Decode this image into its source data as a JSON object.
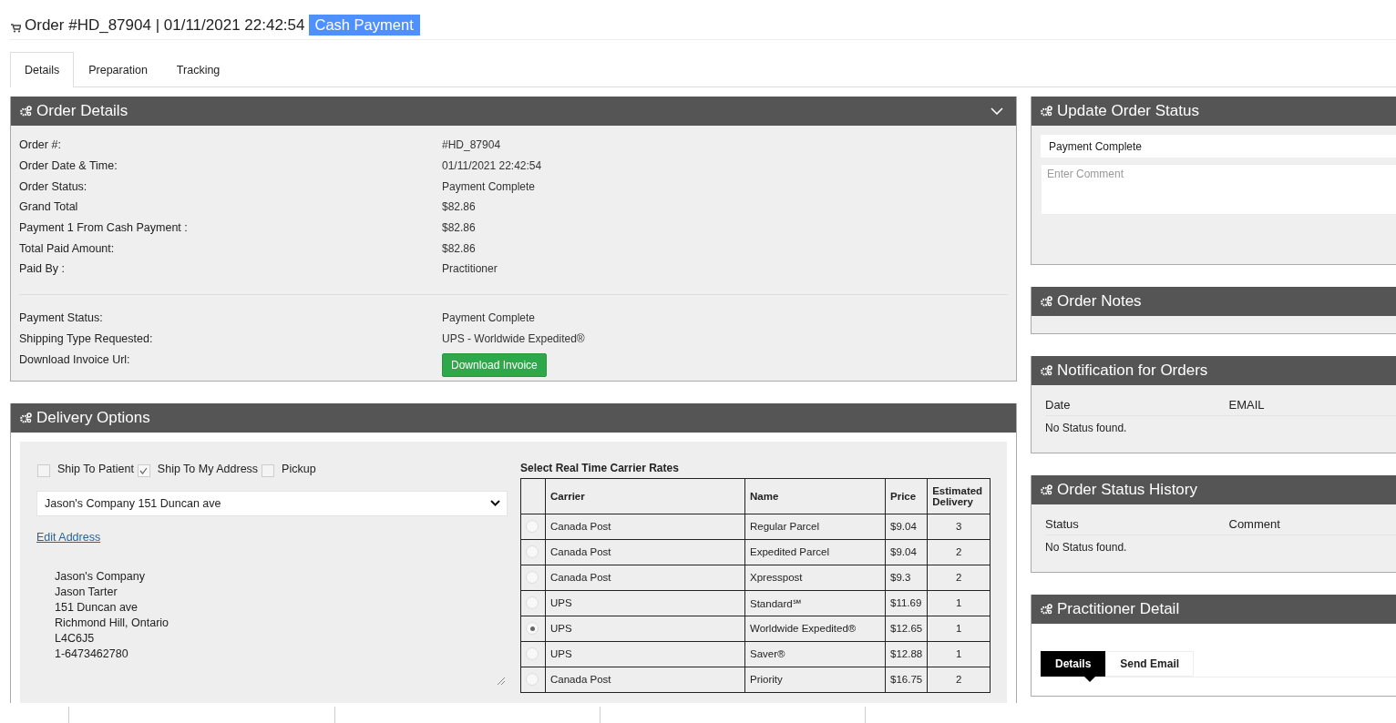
{
  "header": {
    "title": "Order #HD_87904 | 01/11/2021 22:42:54",
    "badge": "Cash Payment"
  },
  "tabs": [
    {
      "label": "Details",
      "selected": true
    },
    {
      "label": "Preparation",
      "selected": false
    },
    {
      "label": "Tracking",
      "selected": false
    }
  ],
  "order_details": {
    "title": "Order Details",
    "rows": [
      {
        "label": "Order #:",
        "value": "#HD_87904"
      },
      {
        "label": "Order Date & Time:",
        "value": "01/11/2021 22:42:54"
      },
      {
        "label": "Order Status:",
        "value": "Payment Complete"
      },
      {
        "label": "Grand Total",
        "value": "$82.86"
      },
      {
        "label": "Payment 1 From Cash Payment :",
        "value": "$82.86"
      },
      {
        "label": "Total Paid Amount:",
        "value": "$82.86"
      },
      {
        "label": "Paid By :",
        "value": "Practitioner"
      }
    ],
    "payment_rows": [
      {
        "label": "Payment Status:",
        "value": "Payment Complete"
      },
      {
        "label": "Shipping Type Requested:",
        "value": "UPS - Worldwide Expedited®"
      }
    ],
    "invoice_label": "Download Invoice Url:",
    "invoice_button": "Download Invoice"
  },
  "delivery_options": {
    "title": "Delivery Options",
    "ship_options": [
      {
        "label": "Ship To Patient",
        "checked": false
      },
      {
        "label": "Ship To My Address",
        "checked": true
      },
      {
        "label": "Pickup",
        "checked": false
      }
    ],
    "address_select": "Jason's Company 151 Duncan ave",
    "edit_link": "Edit Address",
    "address_lines": [
      "Jason's Company",
      "Jason Tarter",
      "151 Duncan ave",
      "Richmond Hill, Ontario",
      "L4C6J5",
      "1-6473462780"
    ],
    "rates_title": "Select Real Time Carrier Rates",
    "rate_columns": [
      "Carrier",
      "Name",
      "Price",
      "Estimated Delivery"
    ],
    "rates": [
      {
        "carrier": "Canada Post",
        "name": "Regular Parcel",
        "price": "$9.04",
        "delivery": "3",
        "selected": false
      },
      {
        "carrier": "Canada Post",
        "name": "Expedited Parcel",
        "price": "$9.04",
        "delivery": "2",
        "selected": false
      },
      {
        "carrier": "Canada Post",
        "name": "Xpresspost",
        "price": "$9.3",
        "delivery": "2",
        "selected": false
      },
      {
        "carrier": "UPS",
        "name": "Standard℠",
        "price": "$11.69",
        "delivery": "1",
        "selected": false
      },
      {
        "carrier": "UPS",
        "name": "Worldwide Expedited®",
        "price": "$12.65",
        "delivery": "1",
        "selected": true
      },
      {
        "carrier": "UPS",
        "name": "Saver®",
        "price": "$12.88",
        "delivery": "1",
        "selected": false
      },
      {
        "carrier": "Canada Post",
        "name": "Priority",
        "price": "$16.75",
        "delivery": "2",
        "selected": false
      }
    ]
  },
  "update_status": {
    "title": "Update Order Status",
    "status_value": "Payment Complete",
    "comment_placeholder": "Enter Comment"
  },
  "order_notes": {
    "title": "Order Notes"
  },
  "notifications": {
    "title": "Notification for Orders",
    "columns": [
      "Date",
      "EMAIL"
    ],
    "empty": "No Status found."
  },
  "status_history": {
    "title": "Order Status History",
    "columns": [
      "Status",
      "Comment"
    ],
    "empty": "No Status found."
  },
  "practitioner": {
    "title": "Practitioner Detail",
    "tabs": [
      {
        "label": "Details",
        "selected": true
      },
      {
        "label": "Send Email",
        "selected": false
      }
    ]
  }
}
